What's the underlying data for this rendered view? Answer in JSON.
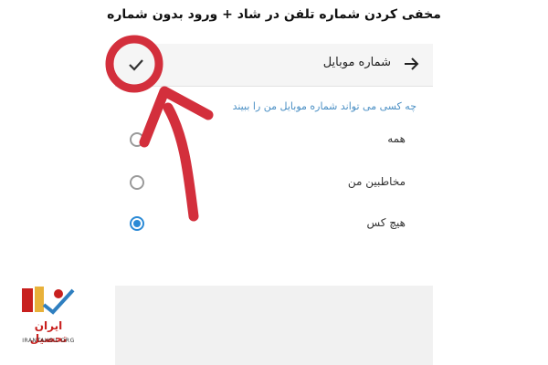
{
  "article": {
    "title": "مخفی کردن شماره تلفن در شاد + ورود بدون شماره"
  },
  "screen": {
    "title": "شماره موبایل",
    "section_header": "چه کسی می تواند شماره موبایل من را ببیند",
    "options": [
      {
        "label": "همه",
        "selected": false
      },
      {
        "label": "مخاطبین من",
        "selected": false
      },
      {
        "label": "هیچ کس",
        "selected": true
      }
    ]
  },
  "logo": {
    "name": "ایران تحصیل",
    "url": "IRANTAHSIL.ORG"
  },
  "colors": {
    "accent": "#2b8ad6",
    "annotation": "#d32f3c",
    "logo_red": "#c8201e"
  },
  "icons": {
    "back": "arrow-right-icon",
    "confirm": "check-icon"
  }
}
